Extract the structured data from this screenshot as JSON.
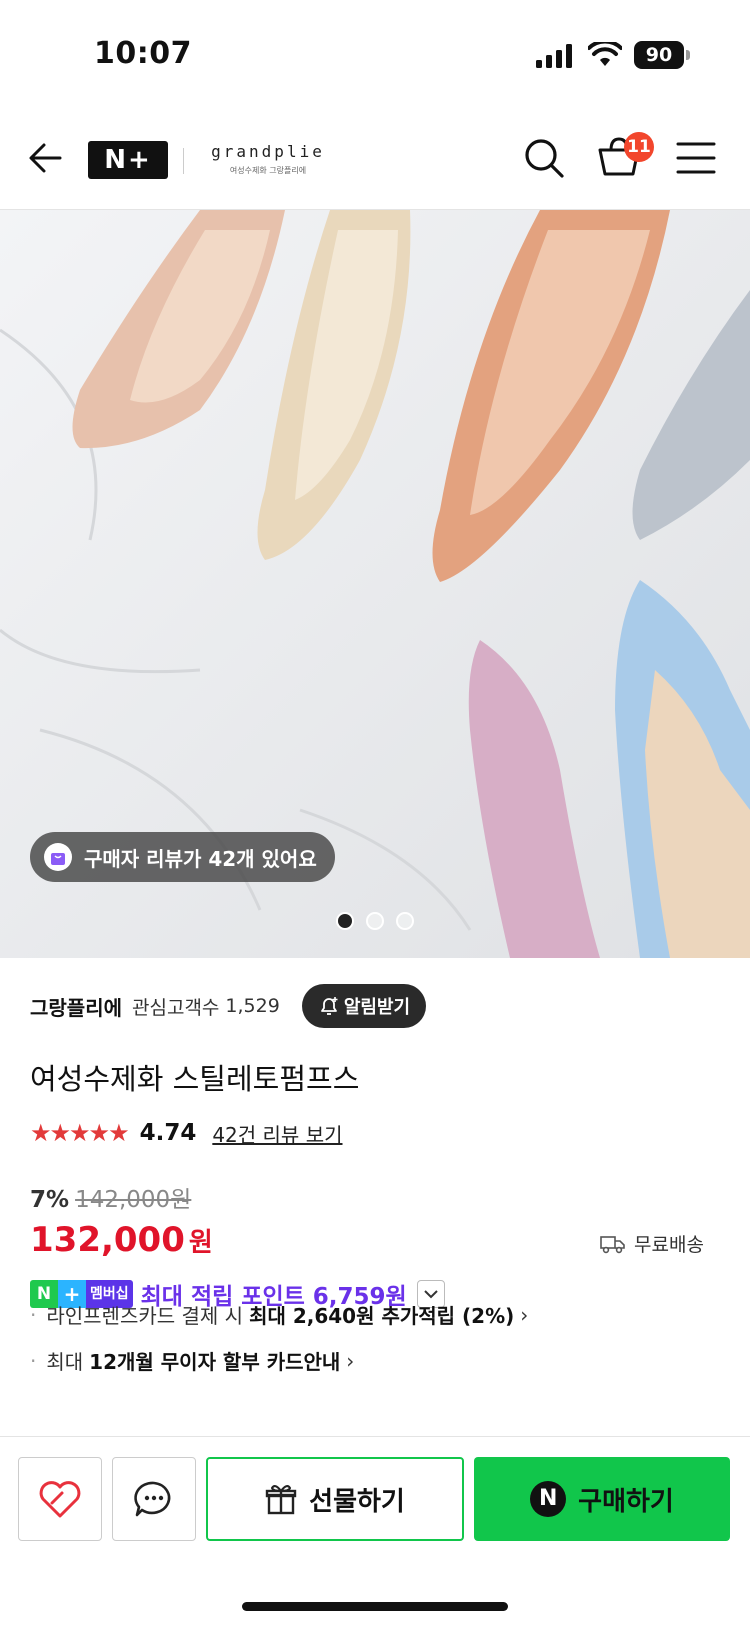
{
  "status_bar": {
    "time": "10:07",
    "battery": "90"
  },
  "header": {
    "logo_text": "N+",
    "brand_name": "grandplie",
    "brand_tagline": "여성수제화 그랑플리에",
    "cart_count": "11"
  },
  "hero": {
    "review_pill": "구매자 리뷰가 42개 있어요",
    "slide_count": 3,
    "active_slide": 0
  },
  "product": {
    "store_name": "그랑플리에",
    "favorite_label": "관심고객수",
    "favorite_count": "1,529",
    "alarm_button": "알림받기",
    "title": "여성수제화 스틸레토펌프스",
    "stars": "★★★★★",
    "rating": "4.74",
    "review_link": "42건 리뷰 보기",
    "discount": "7%",
    "original_price": "142,000원",
    "price": "132,000",
    "price_unit": "원",
    "shipping": "무료배송",
    "membership_badge_n": "N",
    "membership_badge_plus": "+",
    "membership_badge_label": "멤버십",
    "membership_text": "최대 적립 포인트 6,759원",
    "benefit_1_prefix": "라인프렌즈카드 결제 시",
    "benefit_1_bold": "최대 2,640원 추가적립 (2%)",
    "benefit_2_prefix": "최대",
    "benefit_2_bold": "12개월 무이자 할부 카드안내"
  },
  "actions": {
    "gift_label": "선물하기",
    "buy_label": "구매하기",
    "buy_icon_letter": "N"
  },
  "colors": {
    "price_red": "#e0142a",
    "naver_green": "#11c64b",
    "membership_purple": "#6a31e9",
    "badge_red": "#f2462c"
  }
}
